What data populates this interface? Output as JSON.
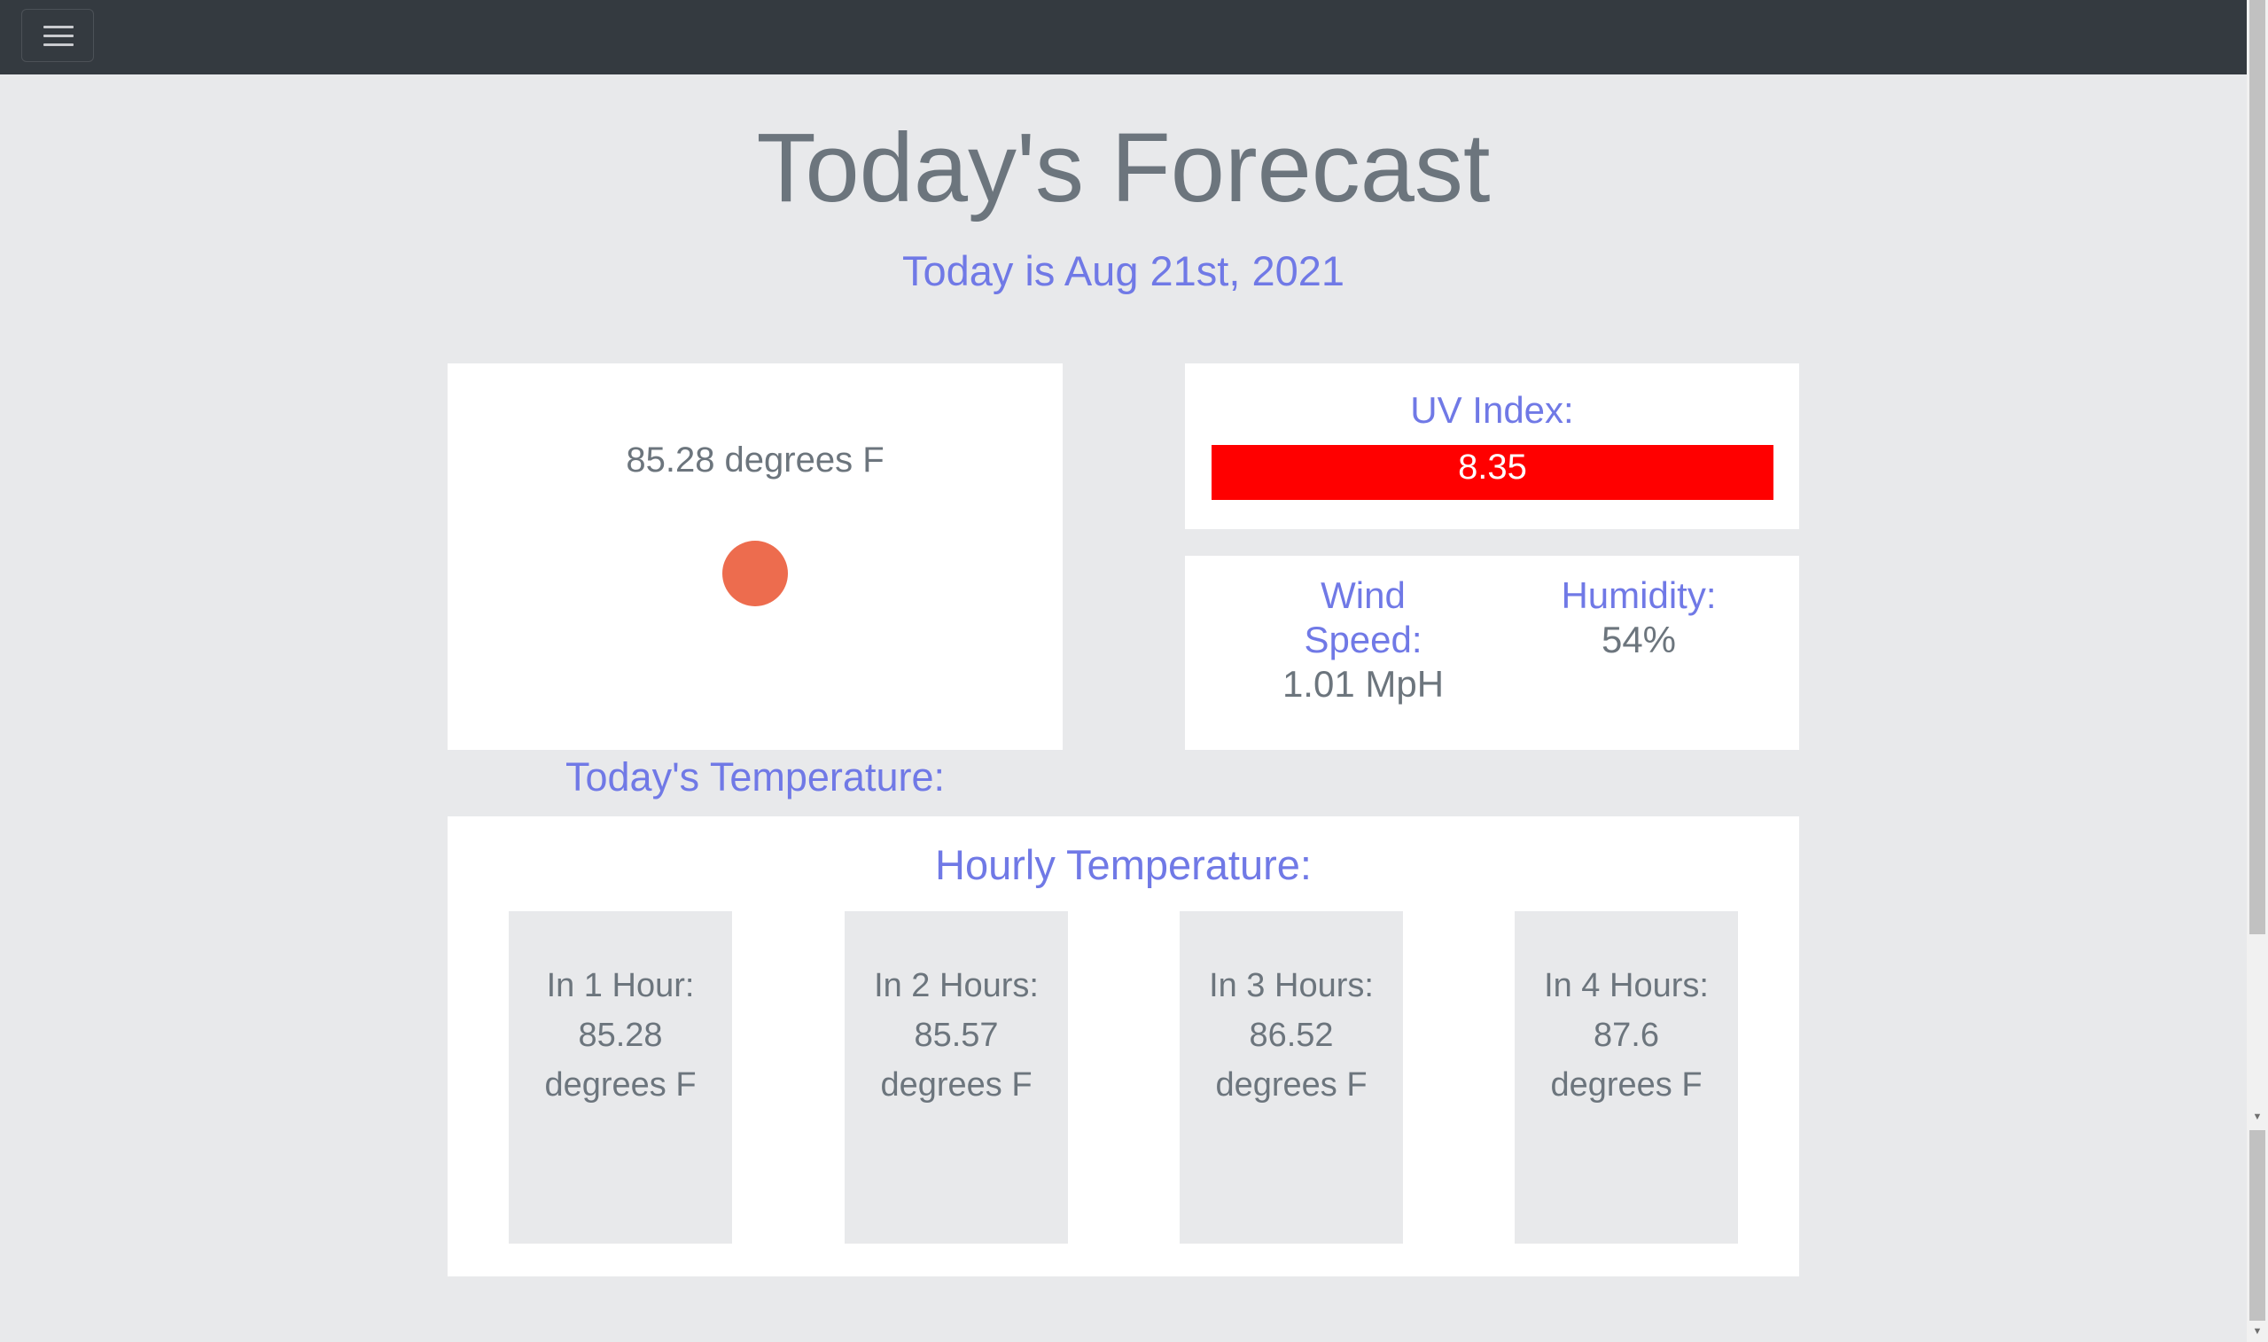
{
  "navbar": {
    "toggler_icon": "hamburger-menu-icon"
  },
  "header": {
    "title": "Today's Forecast",
    "date": "Today is Aug 21st, 2021"
  },
  "temperature": {
    "label": "Today's Temperature:",
    "value": "85.28 degrees F",
    "indicator_color": "#ed6c4e"
  },
  "uv": {
    "label": "UV Index:",
    "value": "8.35",
    "bar_color": "#ff0000"
  },
  "wind": {
    "label_line1": "Wind",
    "label_line2": "Speed:",
    "value": "1.01 MpH"
  },
  "humidity": {
    "label": "Humidity:",
    "value": "54%"
  },
  "hourly": {
    "label": "Hourly Temperature:",
    "items": [
      {
        "label": "In 1 Hour:",
        "value": "85.28",
        "unit": "degrees F"
      },
      {
        "label": "In 2 Hours:",
        "value": "85.57",
        "unit": "degrees F"
      },
      {
        "label": "In 3 Hours:",
        "value": "86.52",
        "unit": "degrees F"
      },
      {
        "label": "In 4 Hours:",
        "value": "87.6",
        "unit": "degrees F"
      }
    ]
  },
  "colors": {
    "accent": "#7079e6",
    "text": "#6c757d",
    "navbar": "#343a40",
    "background": "#e8e9eb"
  }
}
